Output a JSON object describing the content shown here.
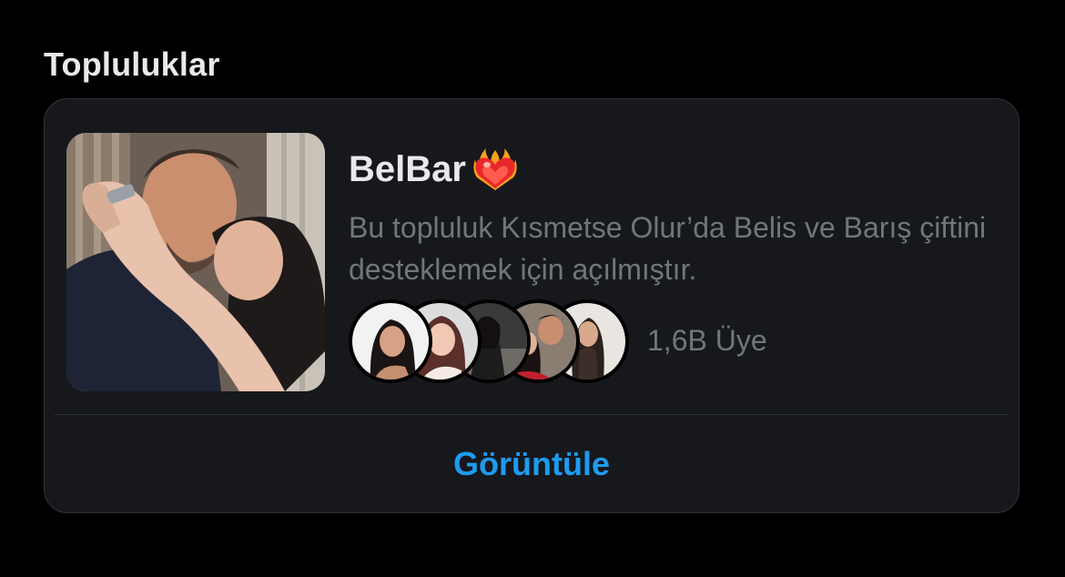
{
  "section": {
    "title": "Topluluklar"
  },
  "community": {
    "name": "BelBar",
    "name_emoji": "heart-on-fire",
    "description": "Bu topluluk Kısmetse Olur’da Belis ve Barış çiftini desteklemek için açılmıştır.",
    "member_count": "1,6B Üye",
    "member_avatars": [
      "member-avatar-1",
      "member-avatar-2",
      "member-avatar-3",
      "member-avatar-4",
      "member-avatar-5"
    ]
  },
  "actions": {
    "view_label": "Görüntüle"
  },
  "colors": {
    "background": "#000000",
    "card": "#16181c",
    "border": "#2f3336",
    "text_primary": "#e7e9ea",
    "text_secondary": "#71767b",
    "accent": "#1d9bf0"
  }
}
